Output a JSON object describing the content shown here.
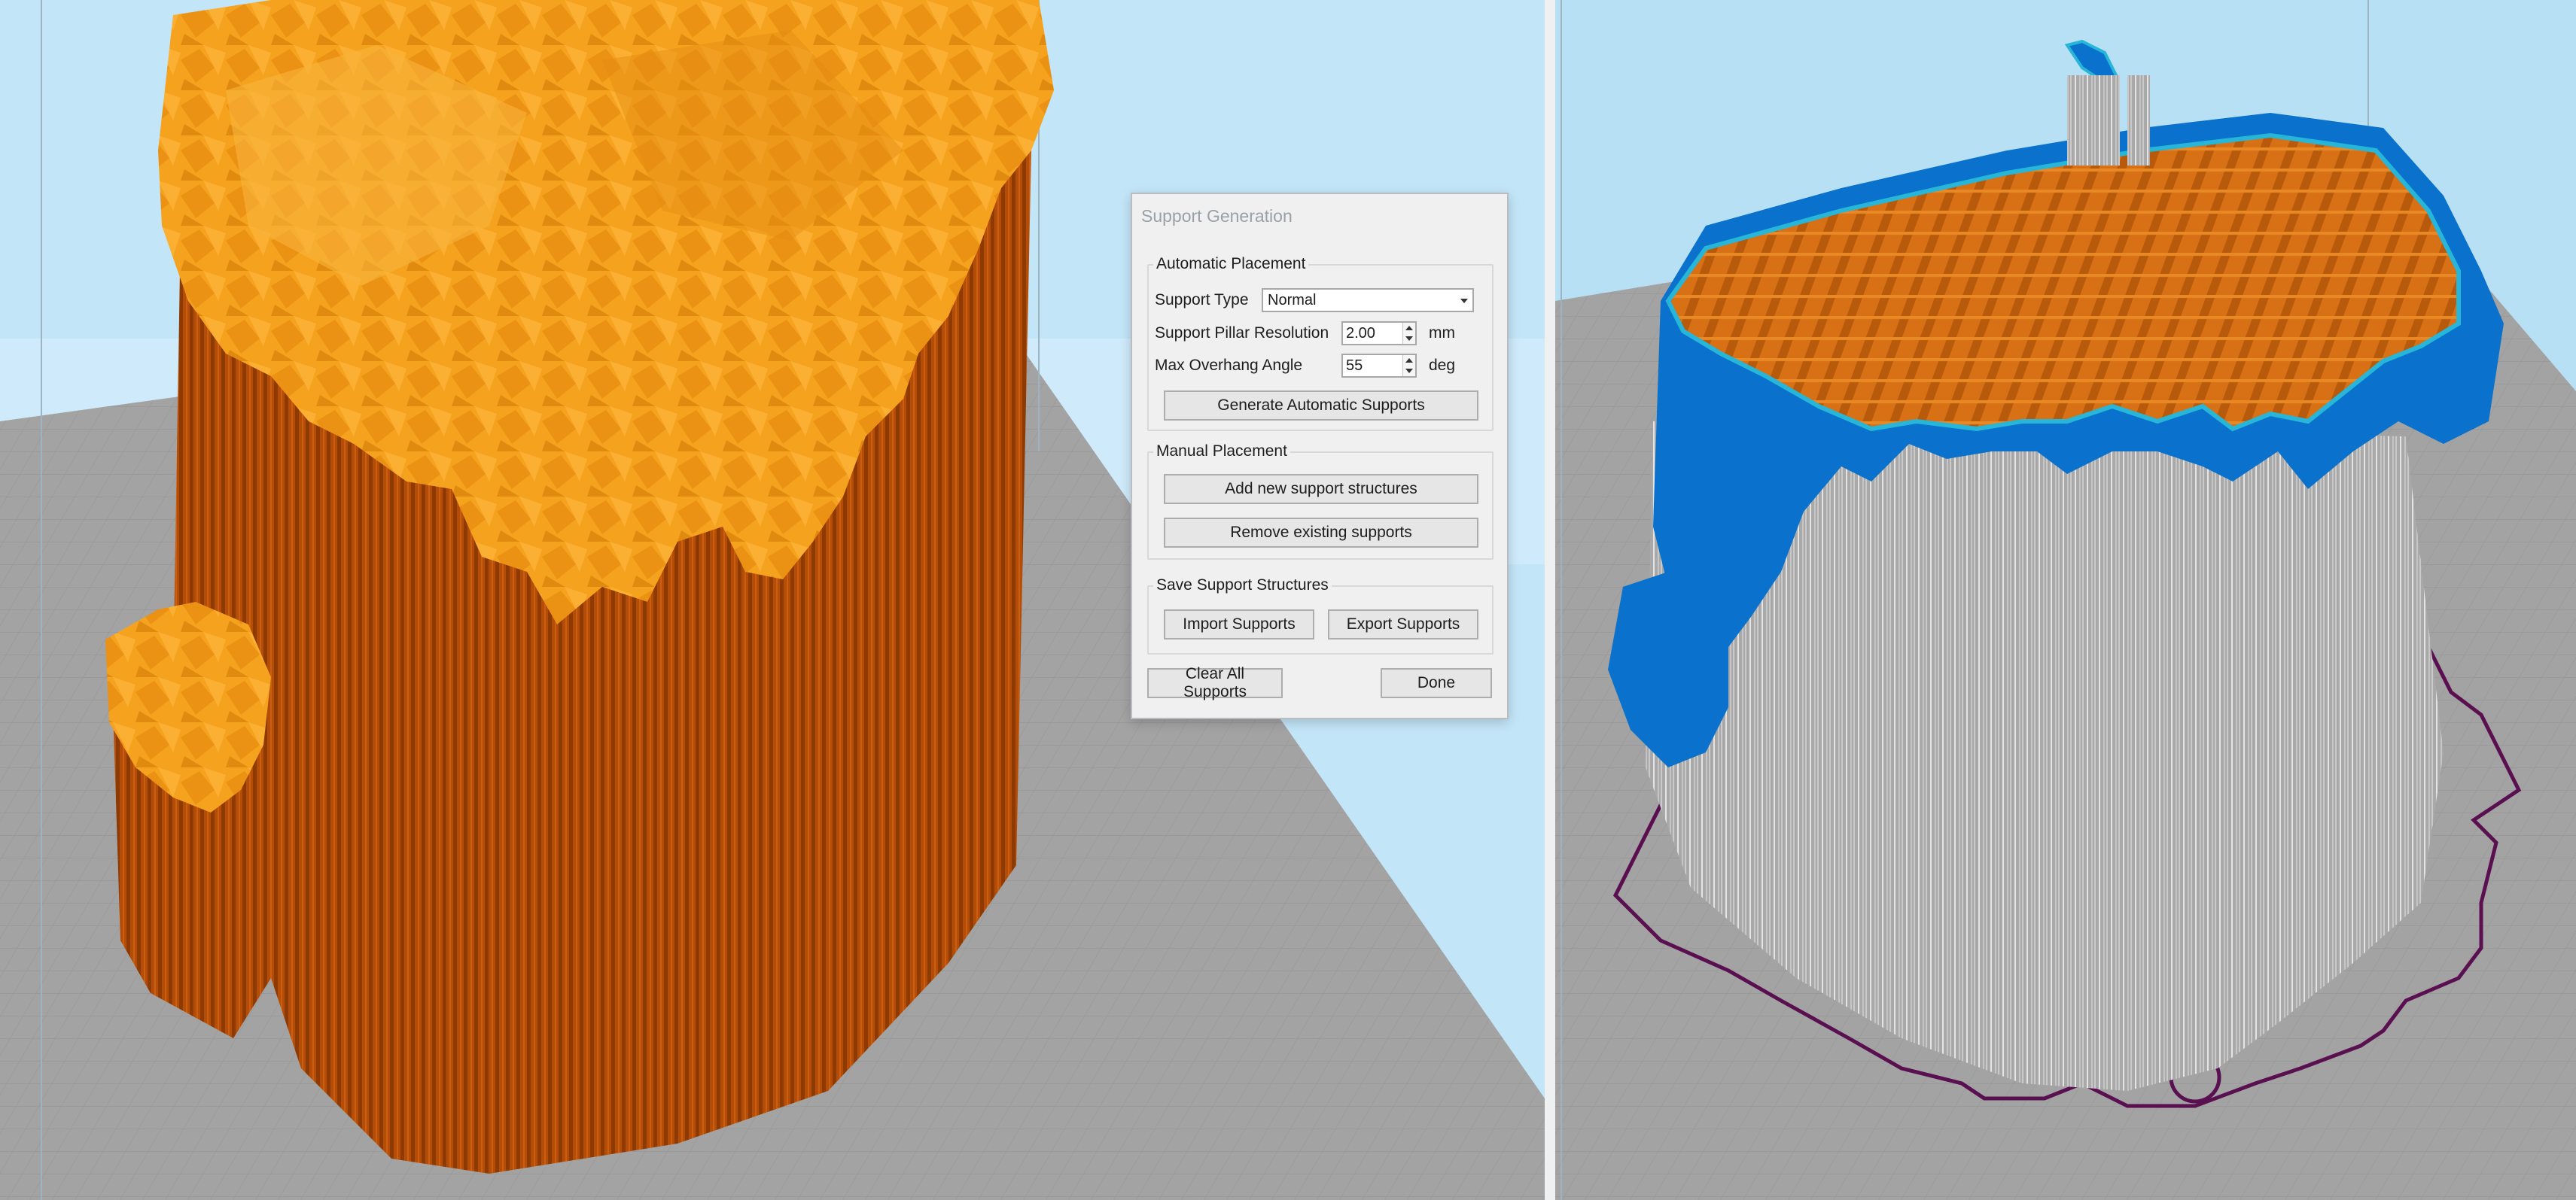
{
  "dialog": {
    "title": "Support Generation",
    "automatic": {
      "title": "Automatic Placement",
      "support_type_label": "Support Type",
      "support_type_value": "Normal",
      "pillar_resolution_label": "Support Pillar Resolution",
      "pillar_resolution_value": "2.00",
      "pillar_resolution_unit": "mm",
      "overhang_label": "Max Overhang Angle",
      "overhang_value": "55",
      "overhang_unit": "deg",
      "generate_button": "Generate Automatic Supports"
    },
    "manual": {
      "title": "Manual Placement",
      "add_button": "Add new support structures",
      "remove_button": "Remove existing supports"
    },
    "save": {
      "title": "Save Support Structures",
      "import_button": "Import Supports",
      "export_button": "Export Supports"
    },
    "clear_button": "Clear All Supports",
    "done_button": "Done"
  },
  "colors": {
    "sky_left": "#bfe3f7",
    "sky_right": "#b8e0f5",
    "build_plate": "#a3a3a3",
    "model_orange": "#f39b1a",
    "support_brown": "#b54d06",
    "selected_blue": "#0a72cc",
    "cross_section_orange": "#d46a12",
    "support_wireframe": "#cfcfcf",
    "outline_purple": "#5a1050"
  },
  "icons": [
    "chevron-down-icon",
    "spin-up-icon",
    "spin-down-icon"
  ]
}
